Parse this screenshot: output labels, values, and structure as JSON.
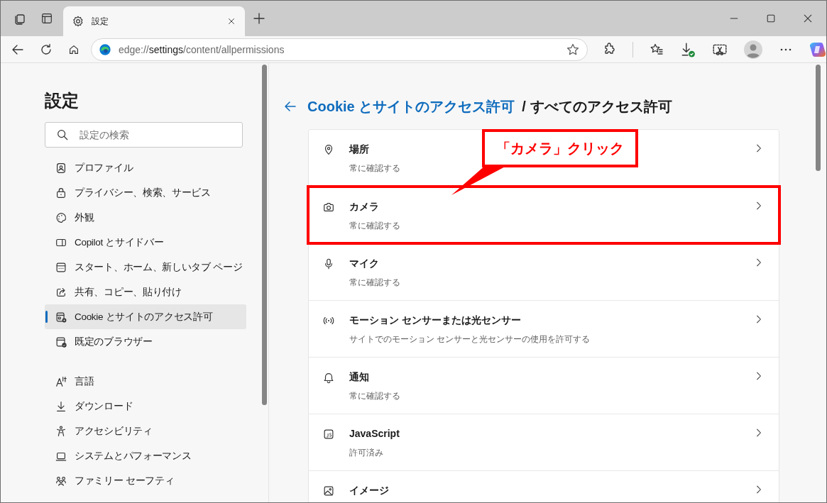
{
  "tabs": [
    {
      "label": "設定",
      "selected": true
    }
  ],
  "address_bar": {
    "scheme": "edge://",
    "host": "settings",
    "path": "/content/allpermissions"
  },
  "sidebar": {
    "title": "設定",
    "search": {
      "placeholder": "設定の検索"
    },
    "groups": [
      {
        "items": [
          {
            "label": "プロファイル",
            "selected": false
          },
          {
            "label": "プライバシー、検索、サービス",
            "selected": false
          },
          {
            "label": "外観",
            "selected": false
          },
          {
            "label": "Copilot とサイドバー",
            "selected": false
          },
          {
            "label": "スタート、ホーム、新しいタブ ページ",
            "selected": false
          },
          {
            "label": "共有、コピー、貼り付け",
            "selected": false
          },
          {
            "label": "Cookie とサイトのアクセス許可",
            "selected": true
          },
          {
            "label": "既定のブラウザー",
            "selected": false
          }
        ]
      },
      {
        "items": [
          {
            "label": "言語",
            "selected": false
          },
          {
            "label": "ダウンロード",
            "selected": false
          },
          {
            "label": "アクセシビリティ",
            "selected": false
          },
          {
            "label": "システムとパフォーマンス",
            "selected": false
          },
          {
            "label": "ファミリー セーフティ",
            "selected": false
          }
        ]
      }
    ]
  },
  "header": {
    "breadcrumb_link": "Cookie とサイトのアクセス許可",
    "separator": "/",
    "current": "すべてのアクセス許可"
  },
  "permissions": [
    {
      "title": "場所",
      "subtitle": "常に確認する",
      "highlighted": false
    },
    {
      "title": "カメラ",
      "subtitle": "常に確認する",
      "highlighted": true
    },
    {
      "title": "マイク",
      "subtitle": "常に確認する",
      "highlighted": false
    },
    {
      "title": "モーション センサーまたは光センサー",
      "subtitle": "サイトでのモーション センサーと光センサーの使用を許可する",
      "highlighted": false
    },
    {
      "title": "通知",
      "subtitle": "常に確認する",
      "highlighted": false
    },
    {
      "title": "JavaScript",
      "subtitle": "許可済み",
      "highlighted": false
    },
    {
      "title": "イメージ",
      "highlighted": false
    }
  ],
  "annotation": {
    "callout": "「カメラ」クリック"
  }
}
